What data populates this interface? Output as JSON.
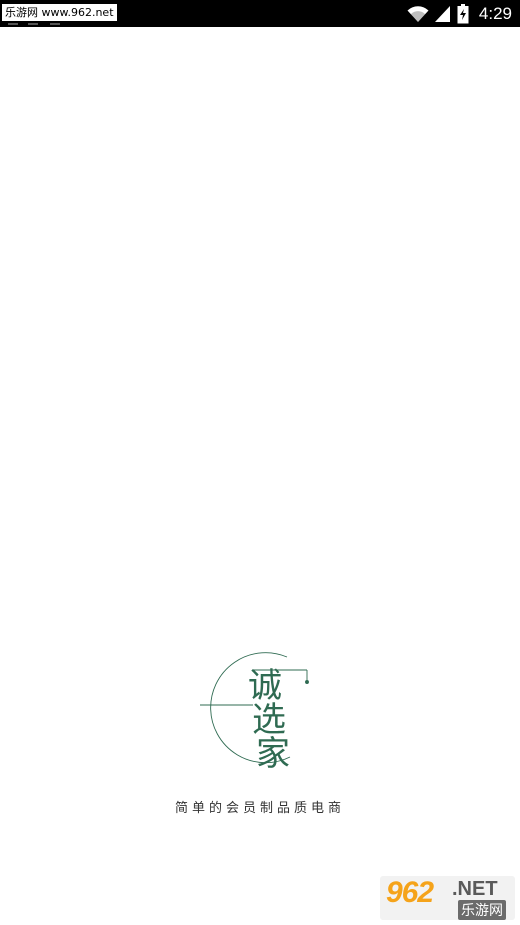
{
  "status_bar": {
    "watermark_text": "乐游网 www.962.net",
    "time": "4:29",
    "icons": [
      "wifi-icon",
      "signal-icon",
      "battery-icon"
    ]
  },
  "splash": {
    "logo_text": "诚选家",
    "tagline": "简单的会员制品质电商",
    "brand_color": "#2f6b52"
  },
  "bottom_watermark": {
    "number": "962",
    "suffix": ".NET",
    "site_name": "乐游网"
  }
}
